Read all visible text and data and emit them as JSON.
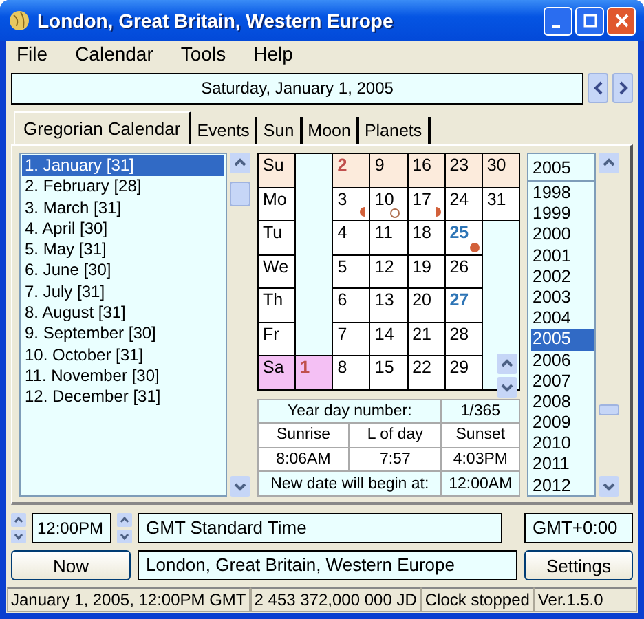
{
  "window": {
    "title": "London, Great Britain, Western Europe"
  },
  "menu": [
    "File",
    "Calendar",
    "Tools",
    "Help"
  ],
  "date_field": {
    "value": "Saturday, January 1, 2005"
  },
  "tabs": [
    {
      "label": "Gregorian Calendar",
      "selected": true
    },
    {
      "label": "Events",
      "selected": false
    },
    {
      "label": "Sun",
      "selected": false
    },
    {
      "label": "Moon",
      "selected": false
    },
    {
      "label": "Planets",
      "selected": false
    }
  ],
  "months": [
    {
      "label": "1. January [31]",
      "selected": true
    },
    {
      "label": "2. February [28]",
      "selected": false
    },
    {
      "label": "3. March [31]",
      "selected": false
    },
    {
      "label": "4. April [30]",
      "selected": false
    },
    {
      "label": "5. May [31]",
      "selected": false
    },
    {
      "label": "6. June [30]",
      "selected": false
    },
    {
      "label": "7. July [31]",
      "selected": false
    },
    {
      "label": "8. August [31]",
      "selected": false
    },
    {
      "label": "9. September [30]",
      "selected": false
    },
    {
      "label": "10. October [31]",
      "selected": false
    },
    {
      "label": "11. November [30]",
      "selected": false
    },
    {
      "label": "12. December [31]",
      "selected": false
    }
  ],
  "calendar": {
    "rows": [
      {
        "label": "Su",
        "kind": "sunday",
        "selected": false,
        "cells": [
          {
            "kind": "blank"
          },
          {
            "kind": "day",
            "day": "2",
            "color": "#c0504d",
            "selected": false
          },
          {
            "kind": "day",
            "day": "9",
            "selected": false
          },
          {
            "kind": "day",
            "day": "16",
            "selected": false
          },
          {
            "kind": "day",
            "day": "23",
            "selected": false
          },
          {
            "kind": "day",
            "day": "30",
            "selected": false
          }
        ]
      },
      {
        "label": "Mo",
        "kind": "weekday",
        "selected": false,
        "cells": [
          {
            "kind": "blank"
          },
          {
            "kind": "day",
            "day": "3",
            "moon": {
              "kind": "last_quarter"
            },
            "selected": false
          },
          {
            "kind": "day",
            "day": "10",
            "moon": {
              "kind": "new"
            },
            "selected": false
          },
          {
            "kind": "day",
            "day": "17",
            "moon": {
              "kind": "first_quarter"
            },
            "selected": false
          },
          {
            "kind": "day",
            "day": "24",
            "selected": false
          },
          {
            "kind": "day",
            "day": "31",
            "selected": false
          }
        ]
      },
      {
        "label": "Tu",
        "kind": "weekday",
        "selected": false,
        "cells": [
          {
            "kind": "blank"
          },
          {
            "kind": "day",
            "day": "4",
            "selected": false
          },
          {
            "kind": "day",
            "day": "11",
            "selected": false
          },
          {
            "kind": "day",
            "day": "18",
            "selected": false
          },
          {
            "kind": "day",
            "day": "25",
            "color": "#2e75b6",
            "moon": {
              "kind": "full"
            },
            "selected": false
          },
          {
            "kind": "blank"
          }
        ]
      },
      {
        "label": "We",
        "kind": "weekday",
        "selected": false,
        "cells": [
          {
            "kind": "blank"
          },
          {
            "kind": "day",
            "day": "5",
            "selected": false
          },
          {
            "kind": "day",
            "day": "12",
            "selected": false
          },
          {
            "kind": "day",
            "day": "19",
            "selected": false
          },
          {
            "kind": "day",
            "day": "26",
            "selected": false
          },
          {
            "kind": "blank"
          }
        ]
      },
      {
        "label": "Th",
        "kind": "weekday",
        "selected": false,
        "cells": [
          {
            "kind": "blank"
          },
          {
            "kind": "day",
            "day": "6",
            "selected": false
          },
          {
            "kind": "day",
            "day": "13",
            "selected": false
          },
          {
            "kind": "day",
            "day": "20",
            "selected": false
          },
          {
            "kind": "day",
            "day": "27",
            "color": "#2e75b6",
            "selected": false
          },
          {
            "kind": "blank"
          }
        ]
      },
      {
        "label": "Fr",
        "kind": "weekday",
        "selected": false,
        "cells": [
          {
            "kind": "blank"
          },
          {
            "kind": "day",
            "day": "7",
            "selected": false
          },
          {
            "kind": "day",
            "day": "14",
            "selected": false
          },
          {
            "kind": "day",
            "day": "21",
            "selected": false
          },
          {
            "kind": "day",
            "day": "28",
            "selected": false
          },
          {
            "kind": "blank"
          }
        ]
      },
      {
        "label": "Sa",
        "kind": "weekday",
        "selected": true,
        "cells": [
          {
            "kind": "day",
            "day": "1",
            "color": "#c0504d",
            "selected": true
          },
          {
            "kind": "day",
            "day": "8",
            "selected": false
          },
          {
            "kind": "day",
            "day": "15",
            "selected": false
          },
          {
            "kind": "day",
            "day": "22",
            "selected": false
          },
          {
            "kind": "day",
            "day": "29",
            "selected": false
          },
          {
            "kind": "blank"
          }
        ]
      }
    ]
  },
  "day_info": {
    "year_day_label": "Year day number:",
    "year_day": "1/365",
    "sunrise_label": "Sunrise",
    "length_label": "L of day",
    "sunset_label": "Sunset",
    "sunrise": "8:06AM",
    "length": "7:57",
    "sunset": "4:03PM",
    "new_date_label": "New date will begin at:",
    "new_date": "12:00AM"
  },
  "year_field": {
    "value": "2005"
  },
  "years": [
    {
      "label": "1998",
      "selected": false
    },
    {
      "label": "1999",
      "selected": false
    },
    {
      "label": "2000",
      "selected": false
    },
    {
      "label": "2001",
      "selected": false
    },
    {
      "label": "2002",
      "selected": false
    },
    {
      "label": "2003",
      "selected": false
    },
    {
      "label": "2004",
      "selected": false
    },
    {
      "label": "2005",
      "selected": true
    },
    {
      "label": "2006",
      "selected": false
    },
    {
      "label": "2007",
      "selected": false
    },
    {
      "label": "2008",
      "selected": false
    },
    {
      "label": "2009",
      "selected": false
    },
    {
      "label": "2010",
      "selected": false
    },
    {
      "label": "2011",
      "selected": false
    },
    {
      "label": "2012",
      "selected": false
    }
  ],
  "time_field": {
    "value": "12:00PM"
  },
  "timezone_field": {
    "value": "GMT Standard Time"
  },
  "offset_field": {
    "value": "GMT+0:00"
  },
  "now_button": "Now",
  "location_field": {
    "value": "London, Great Britain, Western Europe"
  },
  "settings_button": "Settings",
  "status_bar": [
    "January 1, 2005, 12:00PM GMT",
    "2 453 372,000 000 JD",
    "Clock stopped",
    "Ver.1.5.0"
  ]
}
